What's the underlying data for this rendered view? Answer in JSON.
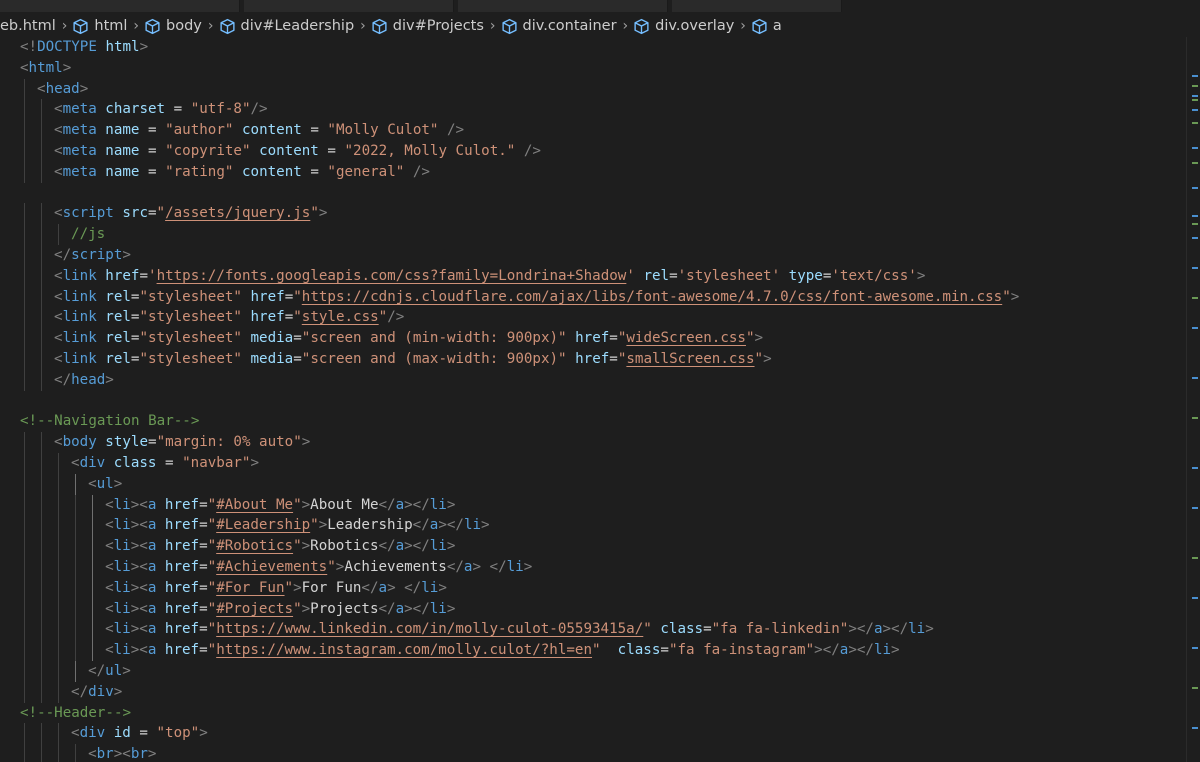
{
  "breadcrumb": [
    {
      "label": "eb.html",
      "icon": ""
    },
    {
      "label": "html",
      "icon": "element-cube-icon"
    },
    {
      "label": "body",
      "icon": "element-cube-icon"
    },
    {
      "label": "div#Leadership",
      "icon": "element-cube-icon"
    },
    {
      "label": "div#Projects",
      "icon": "element-cube-icon"
    },
    {
      "label": "div.container",
      "icon": "element-cube-icon"
    },
    {
      "label": "div.overlay",
      "icon": "element-cube-icon"
    },
    {
      "label": "a",
      "icon": "element-cube-icon"
    }
  ],
  "colors": {
    "background": "#1e1e1e",
    "tag": "#569cd6",
    "attribute": "#9cdcfe",
    "string": "#ce9178",
    "comment": "#6a9955",
    "text": "#d4d4d4",
    "punctuation": "#808080"
  },
  "code_lines": [
    [
      [
        "p",
        "<!"
      ],
      [
        "tag",
        "DOCTYPE"
      ],
      [
        "t",
        " "
      ],
      [
        "attr",
        "html"
      ],
      [
        "p",
        ">"
      ]
    ],
    [
      [
        "p",
        "<"
      ],
      [
        "tag",
        "html"
      ],
      [
        "p",
        ">"
      ]
    ],
    [
      [
        "p",
        "<"
      ],
      [
        "tag",
        "head"
      ],
      [
        "p",
        ">"
      ]
    ],
    [
      [
        "p",
        "<"
      ],
      [
        "tag",
        "meta"
      ],
      [
        "t",
        " "
      ],
      [
        "attr",
        "charset"
      ],
      [
        "t",
        " = "
      ],
      [
        "str",
        "\"utf-8\""
      ],
      [
        "p",
        "/>"
      ]
    ],
    [
      [
        "p",
        "<"
      ],
      [
        "tag",
        "meta"
      ],
      [
        "t",
        " "
      ],
      [
        "attr",
        "name"
      ],
      [
        "t",
        " = "
      ],
      [
        "str",
        "\"author\""
      ],
      [
        "t",
        " "
      ],
      [
        "attr",
        "content"
      ],
      [
        "t",
        " = "
      ],
      [
        "str",
        "\"Molly Culot\""
      ],
      [
        "t",
        " "
      ],
      [
        "p",
        "/>"
      ]
    ],
    [
      [
        "p",
        "<"
      ],
      [
        "tag",
        "meta"
      ],
      [
        "t",
        " "
      ],
      [
        "attr",
        "name"
      ],
      [
        "t",
        " = "
      ],
      [
        "str",
        "\"copyrite\""
      ],
      [
        "t",
        " "
      ],
      [
        "attr",
        "content"
      ],
      [
        "t",
        " = "
      ],
      [
        "str",
        "\"2022, Molly Culot.\""
      ],
      [
        "t",
        " "
      ],
      [
        "p",
        "/>"
      ]
    ],
    [
      [
        "p",
        "<"
      ],
      [
        "tag",
        "meta"
      ],
      [
        "t",
        " "
      ],
      [
        "attr",
        "name"
      ],
      [
        "t",
        " = "
      ],
      [
        "str",
        "\"rating\""
      ],
      [
        "t",
        " "
      ],
      [
        "attr",
        "content"
      ],
      [
        "t",
        " = "
      ],
      [
        "str",
        "\"general\""
      ],
      [
        "t",
        " "
      ],
      [
        "p",
        "/>"
      ]
    ],
    [],
    [
      [
        "p",
        "<"
      ],
      [
        "tag",
        "script"
      ],
      [
        "t",
        " "
      ],
      [
        "attr",
        "src"
      ],
      [
        "t",
        "="
      ],
      [
        "str",
        "\""
      ],
      [
        "link",
        "/assets/jquery.js"
      ],
      [
        "str",
        "\""
      ],
      [
        "p",
        ">"
      ]
    ],
    [
      [
        "comment",
        "//js"
      ]
    ],
    [
      [
        "p",
        "</"
      ],
      [
        "tag",
        "script"
      ],
      [
        "p",
        ">"
      ]
    ],
    [
      [
        "p",
        "<"
      ],
      [
        "tag",
        "link"
      ],
      [
        "t",
        " "
      ],
      [
        "attr",
        "href"
      ],
      [
        "t",
        "="
      ],
      [
        "str",
        "'"
      ],
      [
        "link",
        "https://fonts.googleapis.com/css?family=Londrina+Shadow"
      ],
      [
        "str",
        "'"
      ],
      [
        "t",
        " "
      ],
      [
        "attr",
        "rel"
      ],
      [
        "t",
        "="
      ],
      [
        "str",
        "'stylesheet'"
      ],
      [
        "t",
        " "
      ],
      [
        "attr",
        "type"
      ],
      [
        "t",
        "="
      ],
      [
        "str",
        "'text/css'"
      ],
      [
        "p",
        ">"
      ]
    ],
    [
      [
        "p",
        "<"
      ],
      [
        "tag",
        "link"
      ],
      [
        "t",
        " "
      ],
      [
        "attr",
        "rel"
      ],
      [
        "t",
        "="
      ],
      [
        "str",
        "\"stylesheet\""
      ],
      [
        "t",
        " "
      ],
      [
        "attr",
        "href"
      ],
      [
        "t",
        "="
      ],
      [
        "str",
        "\""
      ],
      [
        "link",
        "https://cdnjs.cloudflare.com/ajax/libs/font-awesome/4.7.0/css/font-awesome.min.css"
      ],
      [
        "str",
        "\""
      ],
      [
        "p",
        ">"
      ]
    ],
    [
      [
        "p",
        "<"
      ],
      [
        "tag",
        "link"
      ],
      [
        "t",
        " "
      ],
      [
        "attr",
        "rel"
      ],
      [
        "t",
        "="
      ],
      [
        "str",
        "\"stylesheet\""
      ],
      [
        "t",
        " "
      ],
      [
        "attr",
        "href"
      ],
      [
        "t",
        "="
      ],
      [
        "str",
        "\""
      ],
      [
        "link",
        "style.css"
      ],
      [
        "str",
        "\""
      ],
      [
        "p",
        "/>"
      ]
    ],
    [
      [
        "p",
        "<"
      ],
      [
        "tag",
        "link"
      ],
      [
        "t",
        " "
      ],
      [
        "attr",
        "rel"
      ],
      [
        "t",
        "="
      ],
      [
        "str",
        "\"stylesheet\""
      ],
      [
        "t",
        " "
      ],
      [
        "attr",
        "media"
      ],
      [
        "t",
        "="
      ],
      [
        "str",
        "\"screen and (min-width: 900px)\""
      ],
      [
        "t",
        " "
      ],
      [
        "attr",
        "href"
      ],
      [
        "t",
        "="
      ],
      [
        "str",
        "\""
      ],
      [
        "link",
        "wideScreen.css"
      ],
      [
        "str",
        "\""
      ],
      [
        "p",
        ">"
      ]
    ],
    [
      [
        "p",
        "<"
      ],
      [
        "tag",
        "link"
      ],
      [
        "t",
        " "
      ],
      [
        "attr",
        "rel"
      ],
      [
        "t",
        "="
      ],
      [
        "str",
        "\"stylesheet\""
      ],
      [
        "t",
        " "
      ],
      [
        "attr",
        "media"
      ],
      [
        "t",
        "="
      ],
      [
        "str",
        "\"screen and (max-width: 900px)\""
      ],
      [
        "t",
        " "
      ],
      [
        "attr",
        "href"
      ],
      [
        "t",
        "="
      ],
      [
        "str",
        "\""
      ],
      [
        "link",
        "smallScreen.css"
      ],
      [
        "str",
        "\""
      ],
      [
        "p",
        ">"
      ]
    ],
    [
      [
        "p",
        "</"
      ],
      [
        "tag",
        "head"
      ],
      [
        "p",
        ">"
      ]
    ],
    [],
    [
      [
        "comment",
        "<!--Navigation Bar-->"
      ]
    ],
    [
      [
        "p",
        "<"
      ],
      [
        "tag",
        "body"
      ],
      [
        "t",
        " "
      ],
      [
        "attr",
        "style"
      ],
      [
        "t",
        "="
      ],
      [
        "str",
        "\"margin: 0% auto\""
      ],
      [
        "p",
        ">"
      ]
    ],
    [
      [
        "p",
        "<"
      ],
      [
        "tag",
        "div"
      ],
      [
        "t",
        " "
      ],
      [
        "attr",
        "class"
      ],
      [
        "t",
        " = "
      ],
      [
        "str",
        "\"navbar\""
      ],
      [
        "p",
        ">"
      ]
    ],
    [
      [
        "p",
        "<"
      ],
      [
        "tag",
        "ul"
      ],
      [
        "p",
        ">"
      ]
    ],
    [
      [
        "p",
        "<"
      ],
      [
        "tag",
        "li"
      ],
      [
        "p",
        "><"
      ],
      [
        "tag",
        "a"
      ],
      [
        "t",
        " "
      ],
      [
        "attr",
        "href"
      ],
      [
        "t",
        "="
      ],
      [
        "str",
        "\""
      ],
      [
        "link",
        "#About Me"
      ],
      [
        "str",
        "\""
      ],
      [
        "p",
        ">"
      ],
      [
        "t",
        "About Me"
      ],
      [
        "p",
        "</"
      ],
      [
        "tag",
        "a"
      ],
      [
        "p",
        "></"
      ],
      [
        "tag",
        "li"
      ],
      [
        "p",
        ">"
      ]
    ],
    [
      [
        "p",
        "<"
      ],
      [
        "tag",
        "li"
      ],
      [
        "p",
        "><"
      ],
      [
        "tag",
        "a"
      ],
      [
        "t",
        " "
      ],
      [
        "attr",
        "href"
      ],
      [
        "t",
        "="
      ],
      [
        "str",
        "\""
      ],
      [
        "link",
        "#Leadership"
      ],
      [
        "str",
        "\""
      ],
      [
        "p",
        ">"
      ],
      [
        "t",
        "Leadership"
      ],
      [
        "p",
        "</"
      ],
      [
        "tag",
        "a"
      ],
      [
        "p",
        "></"
      ],
      [
        "tag",
        "li"
      ],
      [
        "p",
        ">"
      ]
    ],
    [
      [
        "p",
        "<"
      ],
      [
        "tag",
        "li"
      ],
      [
        "p",
        "><"
      ],
      [
        "tag",
        "a"
      ],
      [
        "t",
        " "
      ],
      [
        "attr",
        "href"
      ],
      [
        "t",
        "="
      ],
      [
        "str",
        "\""
      ],
      [
        "link",
        "#Robotics"
      ],
      [
        "str",
        "\""
      ],
      [
        "p",
        ">"
      ],
      [
        "t",
        "Robotics"
      ],
      [
        "p",
        "</"
      ],
      [
        "tag",
        "a"
      ],
      [
        "p",
        "></"
      ],
      [
        "tag",
        "li"
      ],
      [
        "p",
        ">"
      ]
    ],
    [
      [
        "p",
        "<"
      ],
      [
        "tag",
        "li"
      ],
      [
        "p",
        "><"
      ],
      [
        "tag",
        "a"
      ],
      [
        "t",
        " "
      ],
      [
        "attr",
        "href"
      ],
      [
        "t",
        "="
      ],
      [
        "str",
        "\""
      ],
      [
        "link",
        "#Achievements"
      ],
      [
        "str",
        "\""
      ],
      [
        "p",
        ">"
      ],
      [
        "t",
        "Achievements"
      ],
      [
        "p",
        "</"
      ],
      [
        "tag",
        "a"
      ],
      [
        "p",
        "> </"
      ],
      [
        "tag",
        "li"
      ],
      [
        "p",
        ">"
      ]
    ],
    [
      [
        "p",
        "<"
      ],
      [
        "tag",
        "li"
      ],
      [
        "p",
        "><"
      ],
      [
        "tag",
        "a"
      ],
      [
        "t",
        " "
      ],
      [
        "attr",
        "href"
      ],
      [
        "t",
        "="
      ],
      [
        "str",
        "\""
      ],
      [
        "link",
        "#For Fun"
      ],
      [
        "str",
        "\""
      ],
      [
        "p",
        ">"
      ],
      [
        "t",
        "For Fun"
      ],
      [
        "p",
        "</"
      ],
      [
        "tag",
        "a"
      ],
      [
        "p",
        "> </"
      ],
      [
        "tag",
        "li"
      ],
      [
        "p",
        ">"
      ]
    ],
    [
      [
        "p",
        "<"
      ],
      [
        "tag",
        "li"
      ],
      [
        "p",
        "><"
      ],
      [
        "tag",
        "a"
      ],
      [
        "t",
        " "
      ],
      [
        "attr",
        "href"
      ],
      [
        "t",
        "="
      ],
      [
        "str",
        "\""
      ],
      [
        "link",
        "#Projects"
      ],
      [
        "str",
        "\""
      ],
      [
        "p",
        ">"
      ],
      [
        "t",
        "Projects"
      ],
      [
        "p",
        "</"
      ],
      [
        "tag",
        "a"
      ],
      [
        "p",
        "></"
      ],
      [
        "tag",
        "li"
      ],
      [
        "p",
        ">"
      ]
    ],
    [
      [
        "p",
        "<"
      ],
      [
        "tag",
        "li"
      ],
      [
        "p",
        "><"
      ],
      [
        "tag",
        "a"
      ],
      [
        "t",
        " "
      ],
      [
        "attr",
        "href"
      ],
      [
        "t",
        "="
      ],
      [
        "str",
        "\""
      ],
      [
        "link",
        "https://www.linkedin.com/in/molly-culot-05593415a/"
      ],
      [
        "str",
        "\""
      ],
      [
        "t",
        " "
      ],
      [
        "attr",
        "class"
      ],
      [
        "t",
        "="
      ],
      [
        "str",
        "\"fa fa-linkedin\""
      ],
      [
        "p",
        "></"
      ],
      [
        "tag",
        "a"
      ],
      [
        "p",
        "></"
      ],
      [
        "tag",
        "li"
      ],
      [
        "p",
        ">"
      ]
    ],
    [
      [
        "p",
        "<"
      ],
      [
        "tag",
        "li"
      ],
      [
        "p",
        "><"
      ],
      [
        "tag",
        "a"
      ],
      [
        "t",
        " "
      ],
      [
        "attr",
        "href"
      ],
      [
        "t",
        "="
      ],
      [
        "str",
        "\""
      ],
      [
        "link",
        "https://www.instagram.com/molly.culot/?hl=en"
      ],
      [
        "str",
        "\""
      ],
      [
        "t",
        "  "
      ],
      [
        "attr",
        "class"
      ],
      [
        "t",
        "="
      ],
      [
        "str",
        "\"fa fa-instagram\""
      ],
      [
        "p",
        "></"
      ],
      [
        "tag",
        "a"
      ],
      [
        "p",
        "></"
      ],
      [
        "tag",
        "li"
      ],
      [
        "p",
        ">"
      ]
    ],
    [
      [
        "p",
        "</"
      ],
      [
        "tag",
        "ul"
      ],
      [
        "p",
        ">"
      ]
    ],
    [
      [
        "p",
        "</"
      ],
      [
        "tag",
        "div"
      ],
      [
        "p",
        ">"
      ]
    ],
    [
      [
        "comment",
        "<!--Header-->"
      ]
    ],
    [
      [
        "p",
        "<"
      ],
      [
        "tag",
        "div"
      ],
      [
        "t",
        " "
      ],
      [
        "attr",
        "id"
      ],
      [
        "t",
        " = "
      ],
      [
        "str",
        "\"top\""
      ],
      [
        "p",
        ">"
      ]
    ],
    [
      [
        "p",
        "<"
      ],
      [
        "tag",
        "br"
      ],
      [
        "p",
        "><"
      ],
      [
        "tag",
        "br"
      ],
      [
        "p",
        ">"
      ]
    ]
  ]
}
